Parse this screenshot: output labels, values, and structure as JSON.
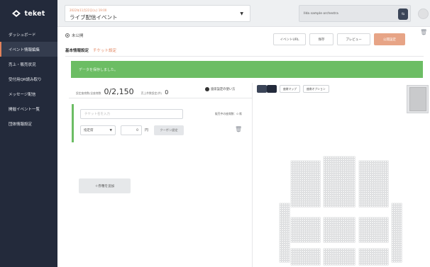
{
  "sidebar": {
    "logo_text": "teket",
    "items": [
      {
        "label": "ダッシュボード",
        "active": false
      },
      {
        "label": "イベント情報編集",
        "active": true
      },
      {
        "label": "売上・販売状況",
        "active": false
      },
      {
        "label": "受付用QR読み取り",
        "active": false
      },
      {
        "label": "メッセージ配信",
        "active": false
      },
      {
        "label": "開催イベント一覧",
        "active": false
      },
      {
        "label": "団体情報設定",
        "active": false
      }
    ]
  },
  "topbar": {
    "event_date": "2022年11月22日(火)  19:00",
    "event_name": "ライブ配信イベント",
    "org_name": "Ilda sample orchestra",
    "switch_icon": "switch-arrows-icon"
  },
  "main": {
    "status_label": "未公開",
    "actions": {
      "event_url": "イベントURL",
      "save": "保存",
      "preview": "プレビュー",
      "publish": "公開設定"
    },
    "tabs": [
      {
        "label": "基本情報設定",
        "active": false
      },
      {
        "label": "チケット設定",
        "active": true
      }
    ],
    "banner_text": "データを保存しました。"
  },
  "ticket_panel": {
    "sold_label": "設定座席数/全座席数",
    "sold_value": "0/2,150",
    "limit_label": "売上件数設定(件)",
    "limit_value": "0",
    "guide_label": "座席設定の使い方",
    "ticket": {
      "name_placeholder": "チケット名を入力",
      "sale_label": "販売中の座席数：0 席",
      "type_value": "指定席",
      "price_value": "0",
      "yen": "円",
      "coupon_label": "クーポン設定"
    },
    "add_label": "＋券種を追加"
  },
  "seatmap": {
    "tool_seatmap": "座席マップ",
    "tool_options": "座席オプション"
  },
  "colors": {
    "sidebar_bg": "#232a3b",
    "accent": "#e2815b",
    "success": "#6cbd64"
  }
}
